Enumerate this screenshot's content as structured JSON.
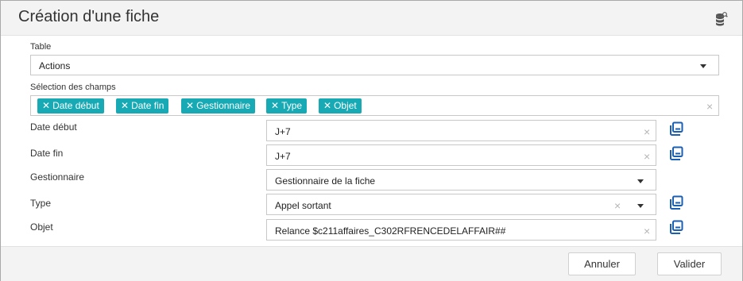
{
  "dialog": {
    "title": "Création d'une fiche",
    "header_icon": "database-search-icon"
  },
  "table_field": {
    "label": "Table",
    "value": "Actions"
  },
  "fields_selection": {
    "label": "Sélection des champs",
    "tags": [
      "Date début",
      "Date fin",
      "Gestionnaire",
      "Type",
      "Objet"
    ],
    "clear_glyph": "×"
  },
  "rows": [
    {
      "label": "Date début",
      "value": "J+7",
      "clear": "×",
      "has_caret": false,
      "has_copy": true
    },
    {
      "label": "Date fin",
      "value": "J+7",
      "clear": "×",
      "has_caret": false,
      "has_copy": true
    },
    {
      "label": "Gestionnaire",
      "value": "Gestionnaire de la fiche",
      "clear": "",
      "has_caret": true,
      "has_copy": false
    },
    {
      "label": "Type",
      "value": "Appel sortant",
      "clear": "×",
      "has_caret": true,
      "has_copy": true
    },
    {
      "label": "Objet",
      "value": "Relance $c211affaires_C302RFRENCEDELAFFAIR##",
      "clear": "×",
      "has_caret": false,
      "has_copy": true
    }
  ],
  "footer": {
    "cancel_label": "Annuler",
    "submit_label": "Valider"
  },
  "colors": {
    "tag_bg": "#17aab5",
    "icon_blue": "#1a5fb4",
    "header_bg": "#f3f3f3"
  }
}
